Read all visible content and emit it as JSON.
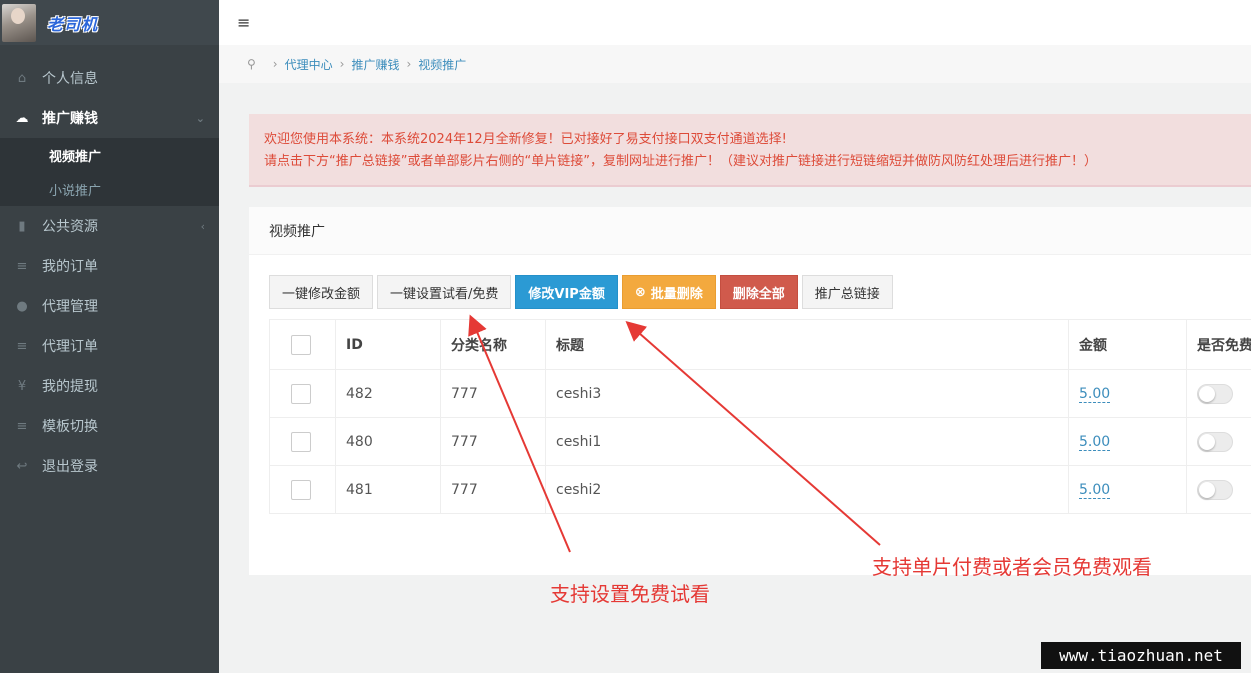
{
  "brand": {
    "title": "老司机"
  },
  "sidebar": {
    "items": [
      {
        "label": "个人信息",
        "icon": "home-icon"
      },
      {
        "label": "推广赚钱",
        "icon": "cloud-icon",
        "active": true
      },
      {
        "label": "公共资源",
        "icon": "video-icon"
      },
      {
        "label": "我的订单",
        "icon": "list-icon"
      },
      {
        "label": "代理管理",
        "icon": "users-icon"
      },
      {
        "label": "代理订单",
        "icon": "bars-icon"
      },
      {
        "label": "我的提现",
        "icon": "yen-icon"
      },
      {
        "label": "模板切换",
        "icon": "list-icon"
      },
      {
        "label": "退出登录",
        "icon": "reply-icon"
      }
    ],
    "submenu": [
      {
        "label": "视频推广",
        "active": true
      },
      {
        "label": "小说推广"
      }
    ]
  },
  "topbar": {
    "menu_icon": "≡"
  },
  "breadcrumb": {
    "items": [
      "代理中心",
      "推广赚钱",
      "视频推广"
    ]
  },
  "alert": {
    "line1": "欢迎您使用本系统：本系统2024年12月全新修复！已对接好了易支付接口双支付通道选择!",
    "line2": "请点击下方“推广总链接”或者单部影片右侧的“单片链接”，复制网址进行推广！（建议对推广链接进行短链缩短并做防风防红处理后进行推广！）"
  },
  "panel": {
    "title": "视频推广",
    "buttons": {
      "edit_amount": "一键修改金额",
      "set_trial": "一键设置试看/免费",
      "edit_vip": "修改VIP金额",
      "batch_delete": "批量删除",
      "delete_all": "删除全部",
      "promo_link": "推广总链接"
    },
    "table": {
      "headers": [
        "ID",
        "分类名称",
        "标题",
        "金额",
        "是否免费"
      ],
      "rows": [
        {
          "id": "482",
          "category": "777",
          "title": "ceshi3",
          "amount": "5.00"
        },
        {
          "id": "480",
          "category": "777",
          "title": "ceshi1",
          "amount": "5.00"
        },
        {
          "id": "481",
          "category": "777",
          "title": "ceshi2",
          "amount": "5.00"
        }
      ]
    }
  },
  "annotations": {
    "trial_note": "支持设置免费试看",
    "single_note": "支持单片付费或者会员免费观看"
  },
  "watermark": "www.tiaozhuan.net",
  "colors": {
    "sidebar_bg": "#3a4145",
    "info": "#2b9ad4",
    "warning": "#f3a93e",
    "danger": "#d05a4c",
    "annotation": "#e53935"
  }
}
